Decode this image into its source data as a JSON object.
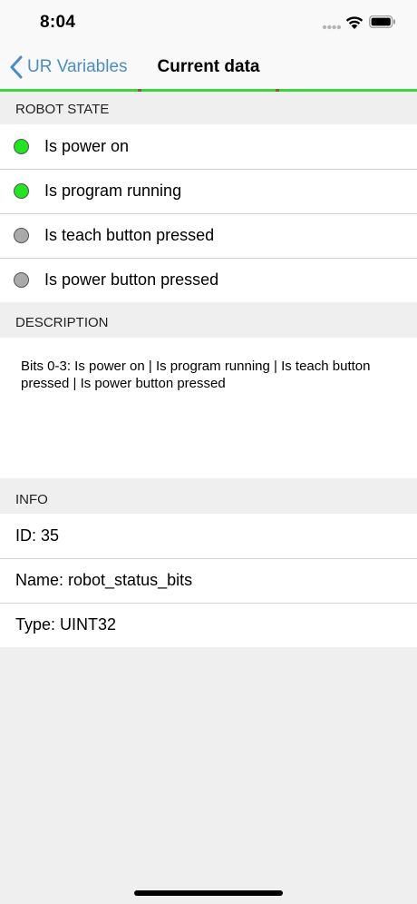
{
  "status_bar": {
    "time": "8:04"
  },
  "nav": {
    "back_label": "UR Variables",
    "title": "Current data"
  },
  "robot_state": {
    "header": "ROBOT STATE",
    "items": [
      {
        "label": "Is power on",
        "state": "on",
        "color": "#22e522"
      },
      {
        "label": "Is program running",
        "state": "on",
        "color": "#22e522"
      },
      {
        "label": "Is teach button pressed",
        "state": "off",
        "color": "#aaaaaa"
      },
      {
        "label": "Is power button pressed",
        "state": "off",
        "color": "#aaaaaa"
      }
    ]
  },
  "description": {
    "header": "DESCRIPTION",
    "text": "Bits 0-3: Is power on | Is program running | Is teach button pressed | Is power button pressed"
  },
  "info": {
    "header": "INFO",
    "rows": [
      {
        "label": "ID: 35"
      },
      {
        "label": "Name: robot_status_bits"
      },
      {
        "label": "Type: UINT32"
      }
    ]
  },
  "colors": {
    "accent": "#4a8dc5",
    "progress": "#3bd63b"
  }
}
